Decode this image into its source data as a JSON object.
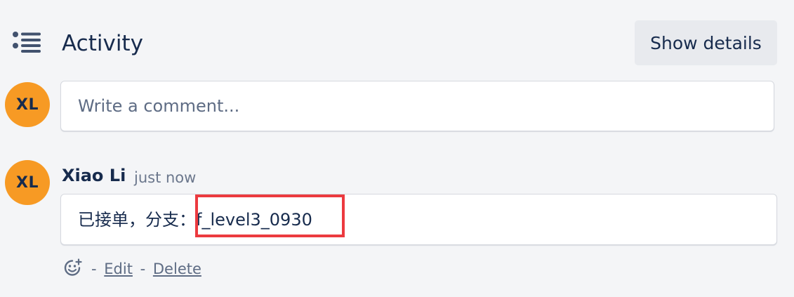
{
  "activity": {
    "title": "Activity",
    "icon": "activity-list-icon",
    "show_details_label": "Show details"
  },
  "current_user": {
    "initials": "XL",
    "avatar_color": "#f79a24"
  },
  "composer": {
    "placeholder": "Write a comment..."
  },
  "comment": {
    "author": "Xiao Li",
    "author_initials": "XL",
    "timestamp": "just now",
    "text": "已接单，分支：f_level3_0930",
    "highlight_color": "#ec3a3f",
    "actions": {
      "reaction_icon": "add-reaction-icon",
      "separator": "-",
      "edit_label": "Edit",
      "delete_label": "Delete"
    }
  }
}
